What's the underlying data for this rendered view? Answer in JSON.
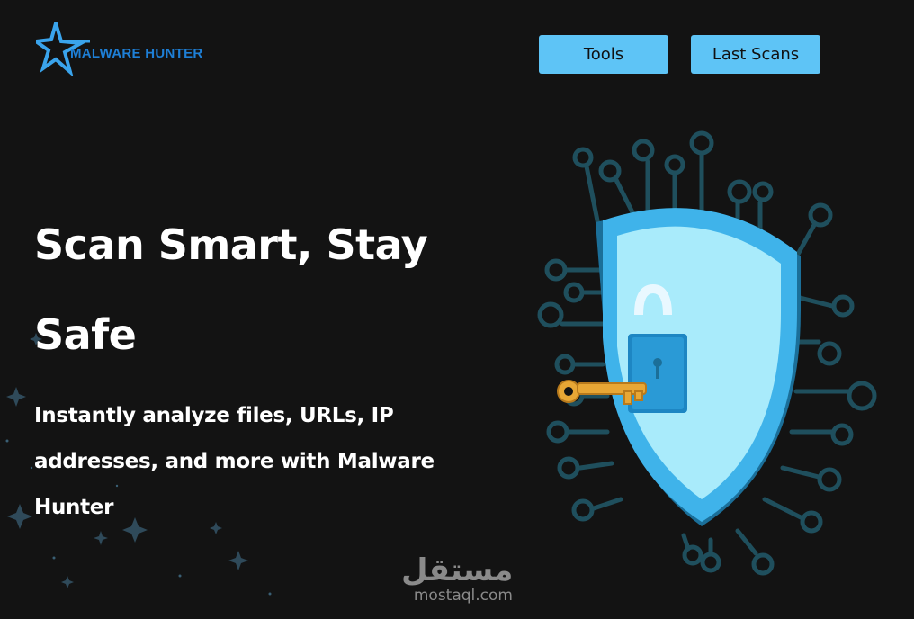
{
  "brand": {
    "name": "MALWARE HUNTER",
    "logo_icon": "star-icon"
  },
  "nav": {
    "tools_label": "Tools",
    "last_scans_label": "Last Scans"
  },
  "hero": {
    "title": "Scan Smart, Stay Safe",
    "subtitle": "Instantly analyze files, URLs, IP addresses, and more with Malware Hunter"
  },
  "illustration": {
    "icon": "shield-lock-key-icon"
  },
  "watermark": {
    "arabic": "مستقل",
    "domain": "mostaql.com"
  },
  "colors": {
    "background": "#131313",
    "accent": "#5ec4f6",
    "brand_text": "#1e7fd6",
    "shield": "#3fb3ea",
    "circuit": "#1f4f5d",
    "key": "#e8a735"
  }
}
